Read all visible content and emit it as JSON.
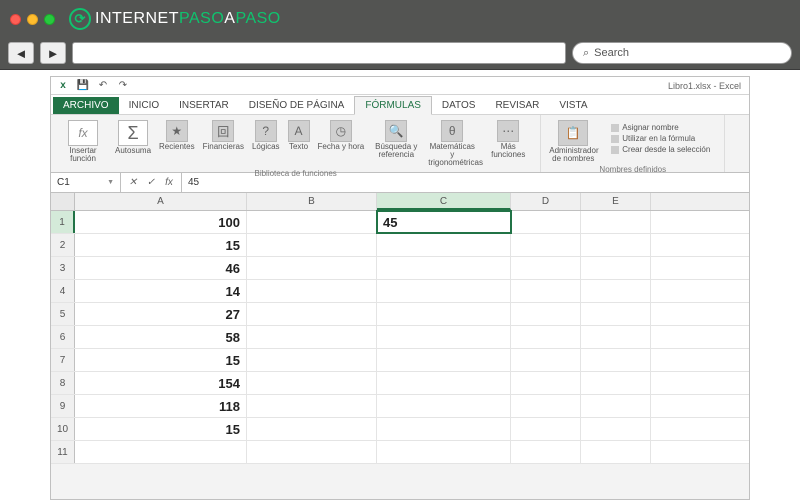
{
  "browser": {
    "logo": {
      "prefix": "INTERNET",
      "mid": "PASO",
      "suffix1": "A",
      "suffix2": "PASO"
    },
    "search_placeholder": "Search"
  },
  "excel": {
    "title": "Libro1.xlsx - Excel",
    "tabs": {
      "archivo": "ARCHIVO",
      "inicio": "INICIO",
      "insertar": "INSERTAR",
      "diseno": "DISEÑO DE PÁGINA",
      "formulas": "FÓRMULAS",
      "datos": "DATOS",
      "revisar": "REVISAR",
      "vista": "VISTA"
    },
    "ribbon": {
      "insertar_funcion": "Insertar\nfunción",
      "autosuma": "Autosuma",
      "recientes": "Recientes",
      "financieras": "Financieras",
      "logicas": "Lógicas",
      "texto": "Texto",
      "fecha": "Fecha y\nhora",
      "busqueda": "Búsqueda y\nreferencia",
      "matematicas": "Matemáticas y\ntrigonométricas",
      "mas": "Más\nfunciones",
      "biblioteca": "Biblioteca de funciones",
      "administrador": "Administrador\nde nombres",
      "asignar": "Asignar nombre",
      "utilizar": "Utilizar en la fórmula",
      "crear": "Crear desde la selección",
      "nombres_def": "Nombres definidos"
    },
    "name_box": "C1",
    "formula_value": "45",
    "columns": [
      "A",
      "B",
      "C",
      "D",
      "E"
    ],
    "col_widths": {
      "A": 172,
      "B": 130,
      "C": 134,
      "D": 70,
      "E": 70
    },
    "selected_cell": "C1",
    "rows": [
      {
        "n": "1",
        "A": "100",
        "C": "45"
      },
      {
        "n": "2",
        "A": "15"
      },
      {
        "n": "3",
        "A": "46"
      },
      {
        "n": "4",
        "A": "14"
      },
      {
        "n": "5",
        "A": "27"
      },
      {
        "n": "6",
        "A": "58"
      },
      {
        "n": "7",
        "A": "15"
      },
      {
        "n": "8",
        "A": "154"
      },
      {
        "n": "9",
        "A": "118"
      },
      {
        "n": "10",
        "A": "15"
      },
      {
        "n": "11",
        "A": ""
      }
    ]
  }
}
